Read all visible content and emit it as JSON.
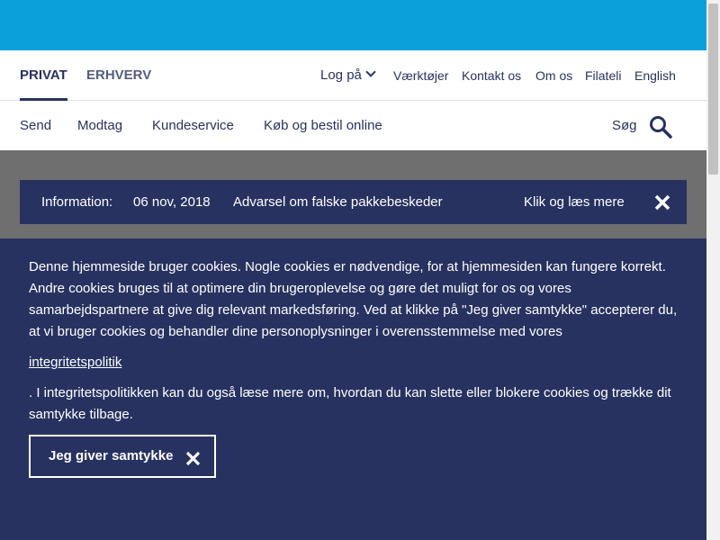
{
  "header": {
    "segments": [
      {
        "label": "PRIVAT"
      },
      {
        "label": "ERHVERV"
      }
    ],
    "login_label": "Log på",
    "utility_links": [
      "Værktøjer",
      "Kontakt os",
      "Om os",
      "Filateli",
      "English"
    ]
  },
  "menu": {
    "items": [
      "Send",
      "Modtag",
      "Kundeservice",
      "Køb og bestil online"
    ],
    "search_label": "Søg"
  },
  "info_bar": {
    "label": "Information:",
    "date": "06 nov, 2018",
    "message": "Advarsel om falske pakkebeskeder",
    "link": "Klik og læs mere"
  },
  "cookie_banner": {
    "text": "Denne hjemmeside bruger cookies. Nogle cookies er nødvendige, for at hjemmesiden kan fungere korrekt. Andre cookies bruges til at optimere din brugeroplevelse og gøre det muligt for os og vores samarbejdspartnere at give dig relevant markedsføring. Ved at klikke på \"Jeg giver samtykke\" accepterer du, at vi bruger cookies og behandler dine personoplysninger i overensstemmelse med vores",
    "policy_link": "integritetspolitik",
    "text2": ". I integritetspolitikken kan du også læse mere om, hvordan du kan slette eller blokere cookies og trække dit samtykke tilbage.",
    "consent_button": "Jeg giver samtykke"
  },
  "colors": {
    "top_bar": "#0ba0da",
    "brand_navy": "#283260",
    "overlay_gray": "#6f6f6f"
  },
  "icons": [
    "chevron-down-icon",
    "search-icon",
    "close-icon"
  ]
}
